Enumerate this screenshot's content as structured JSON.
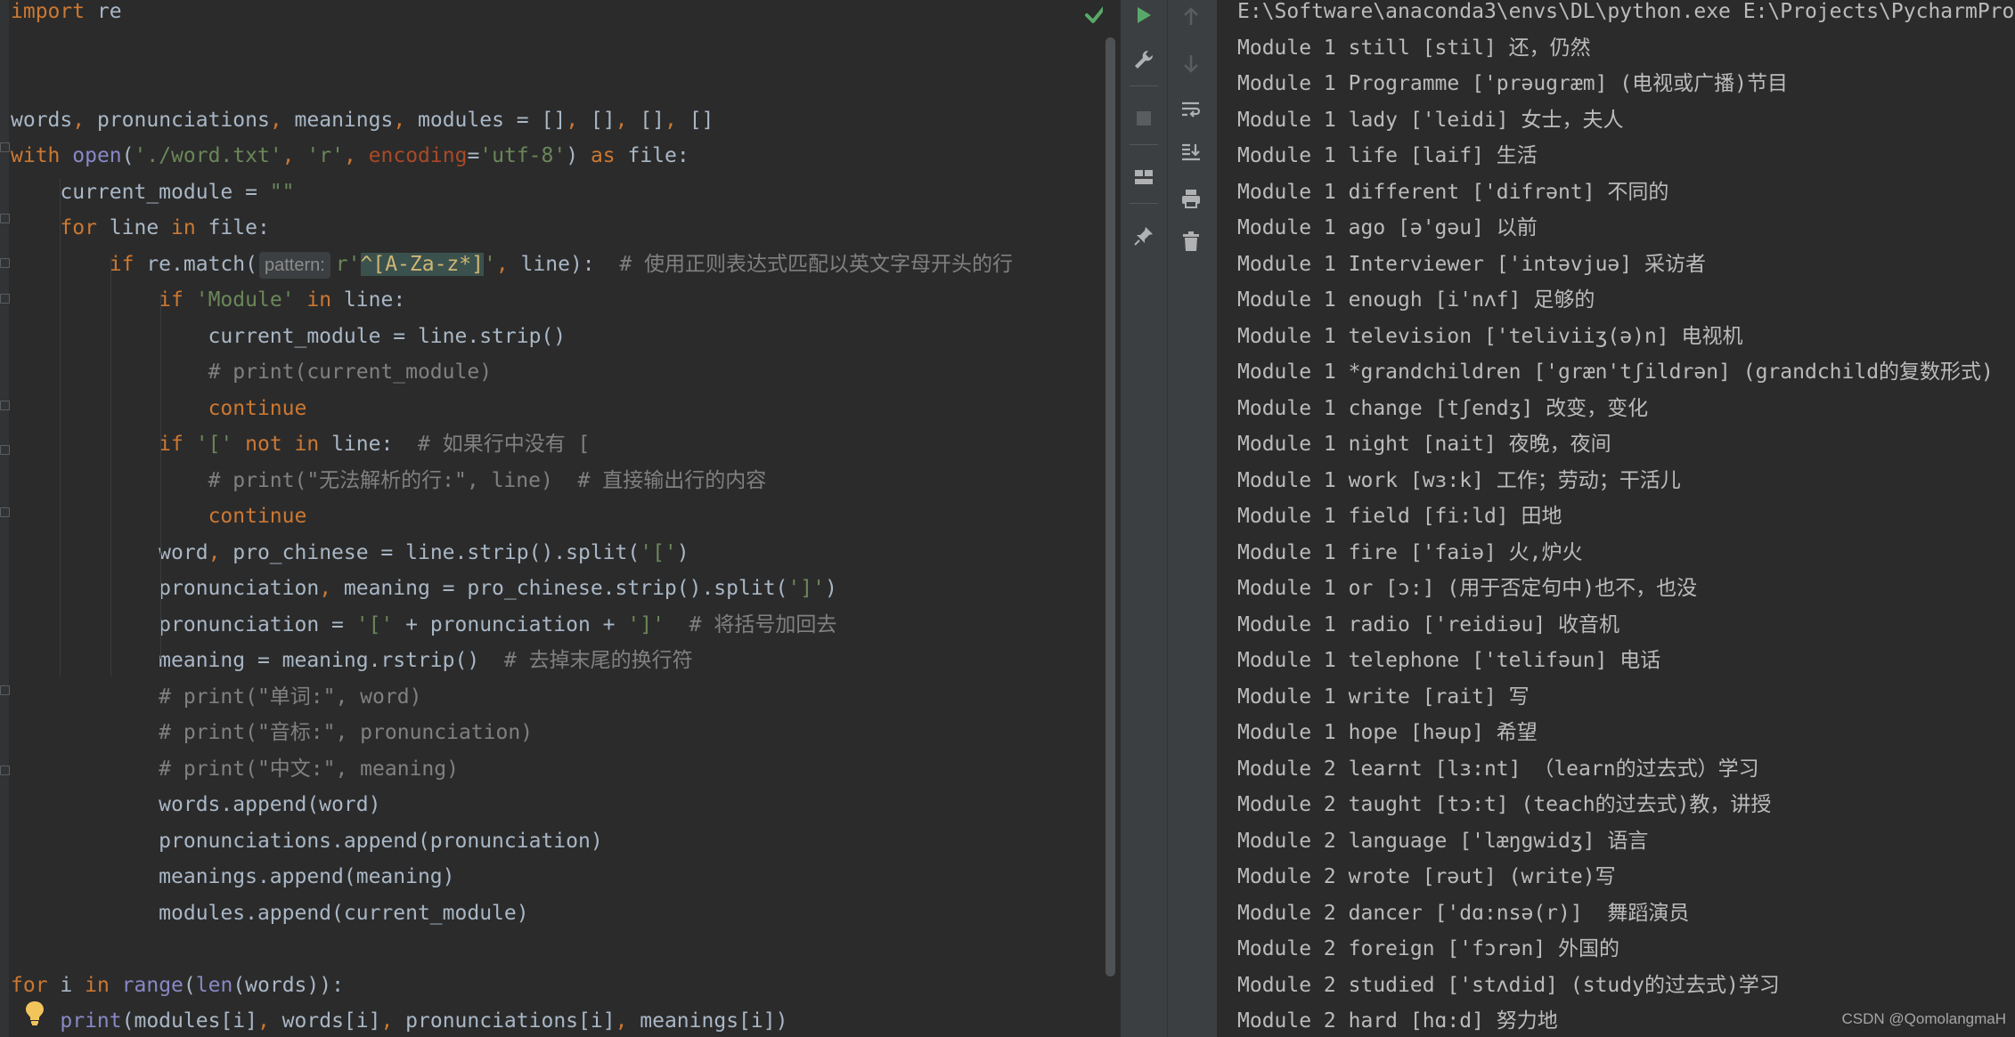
{
  "editor": {
    "lines": [
      [
        {
          "t": "import",
          "c": "kw"
        },
        {
          "t": " re"
        }
      ],
      [],
      [],
      [
        {
          "t": "words"
        },
        {
          "t": ",",
          "c": "kw"
        },
        {
          "t": " pronunciations"
        },
        {
          "t": ",",
          "c": "kw"
        },
        {
          "t": " meanings"
        },
        {
          "t": ",",
          "c": "kw"
        },
        {
          "t": " modules = []"
        },
        {
          "t": ",",
          "c": "kw"
        },
        {
          "t": " []"
        },
        {
          "t": ",",
          "c": "kw"
        },
        {
          "t": " []"
        },
        {
          "t": ",",
          "c": "kw"
        },
        {
          "t": " []"
        }
      ],
      [
        {
          "t": "with",
          "c": "kw"
        },
        {
          "t": " "
        },
        {
          "t": "open",
          "c": "bi"
        },
        {
          "t": "("
        },
        {
          "t": "'./word.txt'",
          "c": "str"
        },
        {
          "t": ",",
          "c": "kw"
        },
        {
          "t": " "
        },
        {
          "t": "'r'",
          "c": "str"
        },
        {
          "t": ",",
          "c": "kw"
        },
        {
          "t": " "
        },
        {
          "t": "encoding",
          "c": "param"
        },
        {
          "t": "="
        },
        {
          "t": "'utf-8'",
          "c": "str"
        },
        {
          "t": ") "
        },
        {
          "t": "as",
          "c": "kw"
        },
        {
          "t": " file:"
        }
      ],
      [
        {
          "t": "    current_module = "
        },
        {
          "t": "\"\"",
          "c": "str"
        }
      ],
      [
        {
          "t": "    "
        },
        {
          "t": "for",
          "c": "kw"
        },
        {
          "t": " line "
        },
        {
          "t": "in",
          "c": "kw"
        },
        {
          "t": " file:"
        }
      ],
      [
        {
          "t": "        "
        },
        {
          "t": "if",
          "c": "kw"
        },
        {
          "t": " re.match("
        },
        {
          "t": "pattern:",
          "c": "hint"
        },
        {
          "t": "r'",
          "c": "str"
        },
        {
          "t": "^[A-Za-z*]",
          "c": "regex-hl"
        },
        {
          "t": "'",
          "c": "str"
        },
        {
          "t": ",",
          "c": "kw"
        },
        {
          "t": " line):  "
        },
        {
          "t": "# 使用正则表达式匹配以英文字母开头的行",
          "c": "cmt"
        }
      ],
      [
        {
          "t": "            "
        },
        {
          "t": "if",
          "c": "kw"
        },
        {
          "t": " "
        },
        {
          "t": "'Module'",
          "c": "str"
        },
        {
          "t": " "
        },
        {
          "t": "in",
          "c": "kw"
        },
        {
          "t": " line:"
        }
      ],
      [
        {
          "t": "                current_module = line.strip()"
        }
      ],
      [
        {
          "t": "                "
        },
        {
          "t": "# print(current_module)",
          "c": "cmt"
        }
      ],
      [
        {
          "t": "                "
        },
        {
          "t": "continue",
          "c": "kw"
        }
      ],
      [
        {
          "t": "            "
        },
        {
          "t": "if",
          "c": "kw"
        },
        {
          "t": " "
        },
        {
          "t": "'['",
          "c": "str"
        },
        {
          "t": " "
        },
        {
          "t": "not in",
          "c": "kw"
        },
        {
          "t": " line:  "
        },
        {
          "t": "# 如果行中没有 [",
          "c": "cmt"
        }
      ],
      [
        {
          "t": "                "
        },
        {
          "t": "# print(\"无法解析的行:\", line)  # 直接输出行的内容",
          "c": "cmt"
        }
      ],
      [
        {
          "t": "                "
        },
        {
          "t": "continue",
          "c": "kw"
        }
      ],
      [
        {
          "t": "            word"
        },
        {
          "t": ",",
          "c": "kw"
        },
        {
          "t": " pro_chinese = line.strip().split("
        },
        {
          "t": "'['",
          "c": "str"
        },
        {
          "t": ")"
        }
      ],
      [
        {
          "t": "            pronunciation"
        },
        {
          "t": ",",
          "c": "kw"
        },
        {
          "t": " meaning = pro_chinese.strip().split("
        },
        {
          "t": "']'",
          "c": "str"
        },
        {
          "t": ")"
        }
      ],
      [
        {
          "t": "            pronunciation = "
        },
        {
          "t": "'['",
          "c": "str"
        },
        {
          "t": " + pronunciation + "
        },
        {
          "t": "']'",
          "c": "str"
        },
        {
          "t": "  "
        },
        {
          "t": "# 将括号加回去",
          "c": "cmt"
        }
      ],
      [
        {
          "t": "            meaning = meaning.rstrip()  "
        },
        {
          "t": "# 去掉末尾的换行符",
          "c": "cmt"
        }
      ],
      [
        {
          "t": "            "
        },
        {
          "t": "# print(\"单词:\", word)",
          "c": "cmt"
        }
      ],
      [
        {
          "t": "            "
        },
        {
          "t": "# print(\"音标:\", pronunciation)",
          "c": "cmt"
        }
      ],
      [
        {
          "t": "            "
        },
        {
          "t": "# print(\"中文:\", meaning)",
          "c": "cmt"
        }
      ],
      [
        {
          "t": "            words.append(word)"
        }
      ],
      [
        {
          "t": "            pronunciations.append(pronunciation)"
        }
      ],
      [
        {
          "t": "            meanings.append(meaning)"
        }
      ],
      [
        {
          "t": "            modules.append(current_module)"
        }
      ],
      [],
      [
        {
          "t": "for",
          "c": "kw"
        },
        {
          "t": " i "
        },
        {
          "t": "in",
          "c": "kw"
        },
        {
          "t": " "
        },
        {
          "t": "range",
          "c": "bi"
        },
        {
          "t": "("
        },
        {
          "t": "len",
          "c": "bi"
        },
        {
          "t": "(words)):"
        }
      ],
      [
        {
          "t": "    "
        },
        {
          "t": "print",
          "c": "bi"
        },
        {
          "t": "(modules[i]"
        },
        {
          "t": ",",
          "c": "kw"
        },
        {
          "t": " words[i]"
        },
        {
          "t": ",",
          "c": "kw"
        },
        {
          "t": " pronunciations[i]"
        },
        {
          "t": ",",
          "c": "kw"
        },
        {
          "t": " meanings[i])"
        }
      ]
    ]
  },
  "toolbar": {
    "left": [
      {
        "name": "run-icon",
        "icon": "run"
      },
      {
        "name": "wrench-icon",
        "icon": "wrench"
      },
      {
        "name": "stop-icon",
        "icon": "stop"
      },
      {
        "name": "layout-icon",
        "icon": "layout"
      },
      {
        "name": "pin-icon",
        "icon": "pin"
      }
    ],
    "right": [
      {
        "name": "up-arrow-icon",
        "icon": "up"
      },
      {
        "name": "down-arrow-icon",
        "icon": "down"
      },
      {
        "name": "soft-wrap-icon",
        "icon": "wrap"
      },
      {
        "name": "scroll-to-end-icon",
        "icon": "scrollend"
      },
      {
        "name": "print-icon",
        "icon": "print"
      },
      {
        "name": "trash-icon",
        "icon": "trash"
      }
    ]
  },
  "console": {
    "lines": [
      "E:\\Software\\anaconda3\\envs\\DL\\python.exe E:\\Projects\\PycharmPro",
      "Module 1 still [stil] 还，仍然",
      "Module 1 Programme ['prəugræm] (电视或广播)节目",
      "Module 1 lady ['leidi] 女士，夫人",
      "Module 1 life [laif] 生活",
      "Module 1 different ['difrənt] 不同的",
      "Module 1 ago [ə'gəu] 以前",
      "Module 1 Interviewer ['intəvjuə] 采访者",
      "Module 1 enough [i'nʌf] 足够的",
      "Module 1 television ['teliviiʒ(ə)n] 电视机",
      "Module 1 *grandchildren ['græn'tʃildrən] (grandchild的复数形式)",
      "Module 1 change [tʃendʒ] 改变，变化",
      "Module 1 night [nait] 夜晚，夜间",
      "Module 1 work [wɜ:k] 工作；劳动；干活儿",
      "Module 1 field [fi:ld] 田地",
      "Module 1 fire ['faiə] 火,炉火",
      "Module 1 or [ɔ:] (用于否定句中)也不，也没",
      "Module 1 radio ['reidiəu] 收音机",
      "Module 1 telephone ['telifəun] 电话",
      "Module 1 write [rait] 写",
      "Module 1 hope [həup] 希望",
      "Module 2 learnt [lɜ:nt] （learn的过去式）学习",
      "Module 2 taught [tɔ:t] (teach的过去式)教，讲授",
      "Module 2 language ['læŋgwidʒ] 语言",
      "Module 2 wrote [rəut] (write)写",
      "Module 2 dancer ['dɑ:nsə(r)]  舞蹈演员",
      "Module 2 foreign ['fɔrən] 外国的",
      "Module 2 studied ['stʌdid] (study的过去式)学习",
      "Module 2 hard [hɑ:d] 努力地"
    ]
  },
  "watermark": "CSDN @QomolangmaH"
}
